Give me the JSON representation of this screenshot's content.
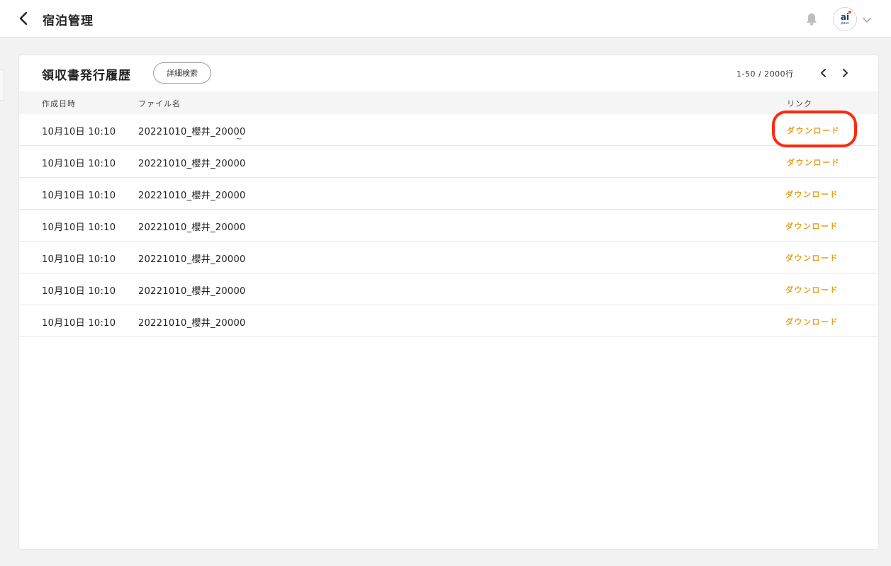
{
  "header": {
    "title": "宿泊管理",
    "back_icon": "chevron-left-icon",
    "bell_icon": "bell-icon",
    "avatar": {
      "main": "ai",
      "sub": "pass"
    }
  },
  "card": {
    "title": "領収書発行履歴",
    "search_button": "詳細検索",
    "pagination": "1-50 / 2000行"
  },
  "table": {
    "columns": {
      "date": "作成日時",
      "file": "ファイル名",
      "link": "リンク"
    },
    "tilde": "~",
    "rows": [
      {
        "date": "10月10日 10:10",
        "file": "20221010_櫻井_20000",
        "link": "ダウンロード"
      },
      {
        "date": "10月10日 10:10",
        "file": "20221010_櫻井_20000",
        "link": "ダウンロード"
      },
      {
        "date": "10月10日 10:10",
        "file": "20221010_櫻井_20000",
        "link": "ダウンロード"
      },
      {
        "date": "10月10日 10:10",
        "file": "20221010_櫻井_20000",
        "link": "ダウンロード"
      },
      {
        "date": "10月10日 10:10",
        "file": "20221010_櫻井_20000",
        "link": "ダウンロード"
      },
      {
        "date": "10月10日 10:10",
        "file": "20221010_櫻井_20000",
        "link": "ダウンロード"
      },
      {
        "date": "10月10日 10:10",
        "file": "20221010_櫻井_20000",
        "link": "ダウンロード"
      }
    ]
  },
  "colors": {
    "link": "#e5a11c",
    "highlight": "#ff2a0d",
    "brand": "#1f3f8c"
  }
}
